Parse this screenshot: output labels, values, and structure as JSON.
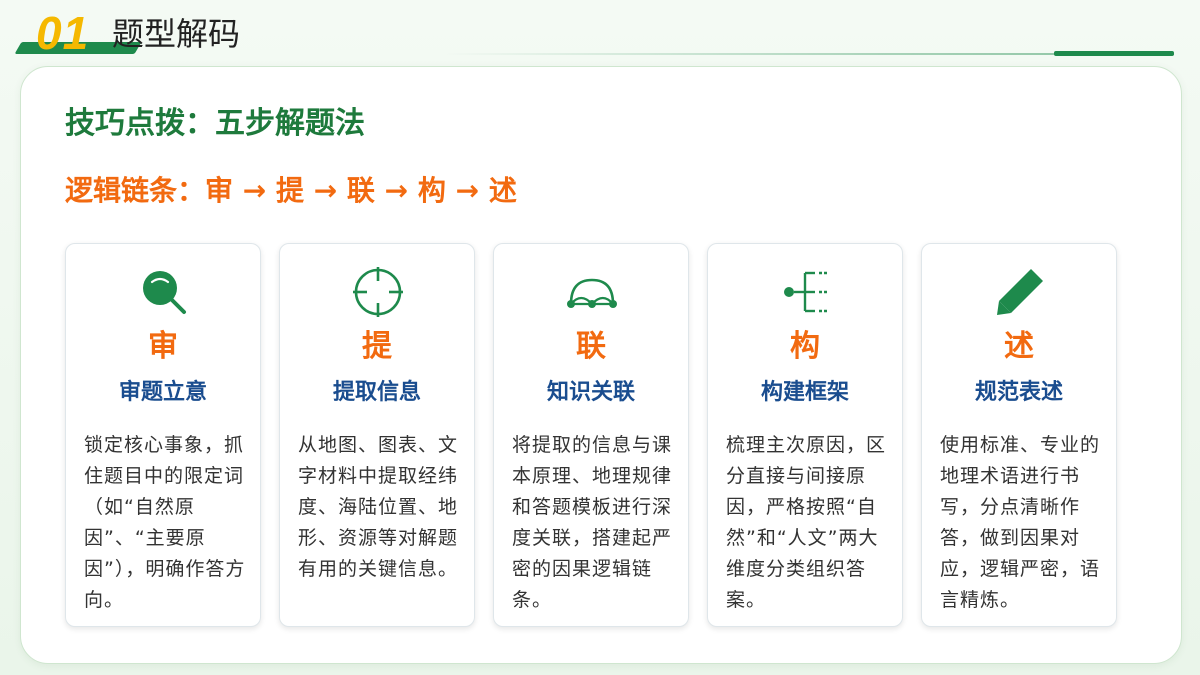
{
  "header": {
    "number": "01",
    "title": "题型解码"
  },
  "panel": {
    "title": "技巧点拨：五步解题法",
    "chain": "逻辑链条：审 → 提 → 联 → 构 → 述"
  },
  "cards": [
    {
      "icon": "magnifier-icon",
      "char": "审",
      "subtitle": "审题立意",
      "desc": "锁定核心事象，抓住题目中的限定词（如“自然原因”、“主要原因”），明确作答方向。"
    },
    {
      "icon": "crosshair-icon",
      "char": "提",
      "subtitle": "提取信息",
      "desc": "从地图、图表、文字材料中提取经纬度、海陆位置、地形、资源等对解题有用的关键信息。"
    },
    {
      "icon": "link-arc-icon",
      "char": "联",
      "subtitle": "知识关联",
      "desc": "将提取的信息与课本原理、地理规律和答题模板进行深度关联，搭建起严密的因果逻辑链条。"
    },
    {
      "icon": "tree-structure-icon",
      "char": "构",
      "subtitle": "构建框架",
      "desc": "梳理主次原因，区分直接与间接原因，严格按照“自然”和“人文”两大维度分类组织答案。"
    },
    {
      "icon": "pencil-icon",
      "char": "述",
      "subtitle": "规范表述",
      "desc": "使用标准、专业的地理术语进行书写，分点清晰作答，做到因果对应，逻辑严密，语言精炼。"
    }
  ],
  "colors": {
    "green": "#1e8a4c",
    "orange": "#f26a10",
    "blue": "#1a4d8f",
    "yellow": "#f5b800"
  }
}
